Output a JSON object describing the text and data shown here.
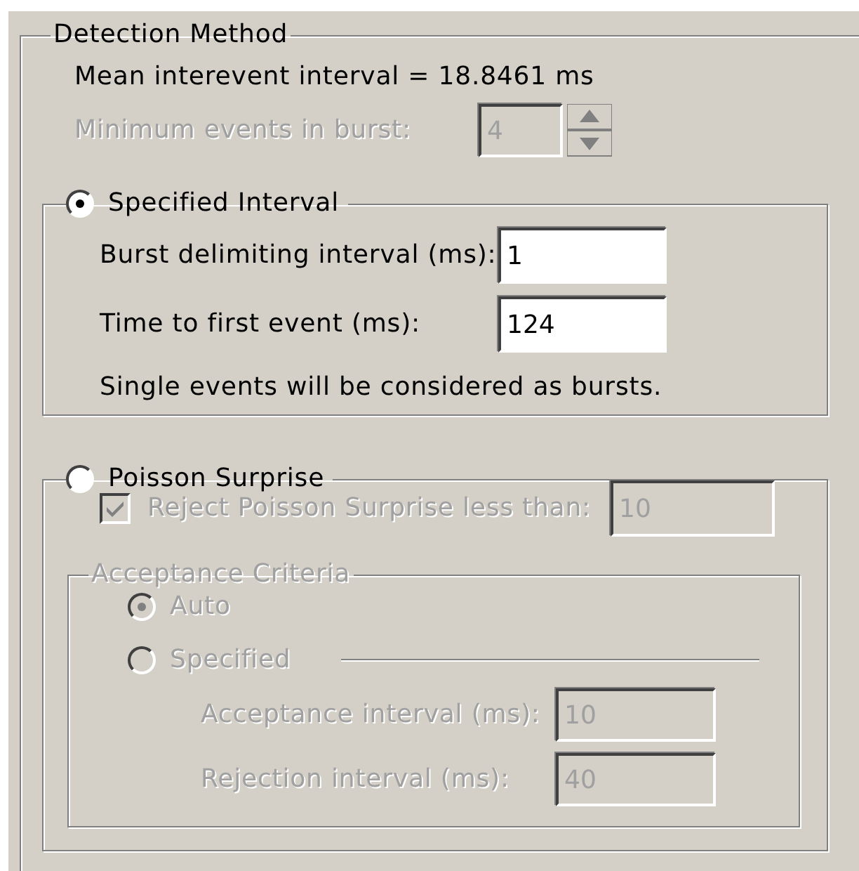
{
  "group": {
    "title": "Detection Method",
    "mean_interval": "Mean interevent interval = 18.8461 ms",
    "min_events": {
      "label": "Minimum events in burst:",
      "value": "4",
      "disabled": true
    },
    "methods": [
      {
        "kind": "interval",
        "label": "Specified Interval",
        "selected": true,
        "fields": [
          {
            "label": "Burst delimiting interval (ms):",
            "value": "1",
            "disabled": false
          },
          {
            "label": "Time to first event (ms):",
            "value": "124",
            "disabled": false
          }
        ],
        "note": "Single events will be considered as bursts."
      },
      {
        "kind": "poisson",
        "label": "Poisson Surprise",
        "selected": false,
        "reject": {
          "label": "Reject Poisson Surprise less than:",
          "checked": true,
          "value": "10",
          "disabled": true
        },
        "acceptance": {
          "title": "Acceptance Criteria",
          "disabled": true,
          "options": [
            {
              "label": "Auto",
              "selected": true
            },
            {
              "label": "Specified",
              "selected": false,
              "fields": [
                {
                  "label": "Acceptance interval (ms):",
                  "value": "10",
                  "disabled": true
                },
                {
                  "label": "Rejection interval (ms):",
                  "value": "40",
                  "disabled": true
                }
              ]
            }
          ]
        }
      }
    ]
  }
}
